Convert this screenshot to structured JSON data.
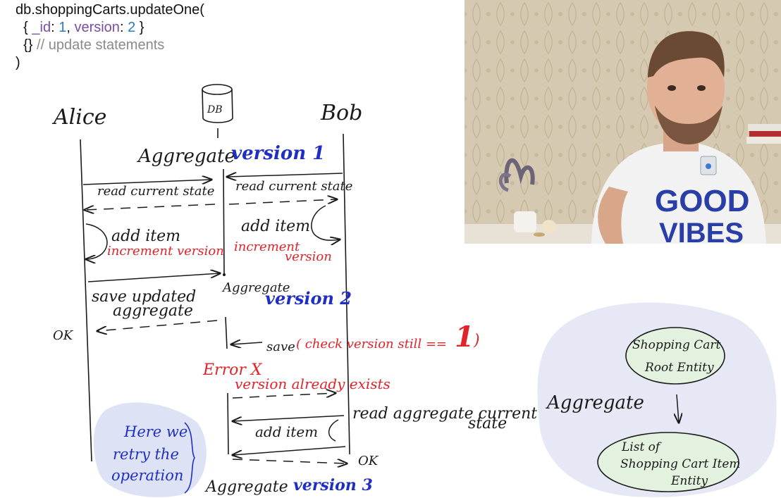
{
  "code": {
    "line1": "db.shoppingCarts.updateOne(",
    "l2_open": "{ ",
    "l2_key1": "_id",
    "l2_colon1": ": ",
    "l2_val1": "1",
    "l2_comma": ", ",
    "l2_key2": "version",
    "l2_colon2": ": ",
    "l2_val2": "2",
    "l2_close": " }",
    "l3_braces": "{} ",
    "l3_comment": "// update statements",
    "line4": ")"
  },
  "diagram": {
    "alice": "Alice",
    "db": "DB",
    "bob": "Bob",
    "aggregate_v1_prefix": "Aggregate",
    "version1": "version 1",
    "alice_read": "read current state",
    "bob_read": "read current state",
    "alice_add": "add item",
    "alice_incr": "increment version",
    "bob_add": "add item",
    "bob_incr_1": "increment",
    "bob_incr_2": "version",
    "save_updated_1": "save updated",
    "save_updated_2": "aggregate",
    "aggregate_v2_prefix": "Aggregate",
    "version2": "version 2",
    "ok_alice": "OK",
    "bob_save": "save",
    "bob_check": "( check version still == ",
    "bob_check_num": "1",
    "bob_check_close": ")",
    "error": "Error X",
    "version_exists": "version already exists",
    "read_agg_1": "read aggregate current",
    "read_agg_2": "state",
    "bob_add2": "add item",
    "ok_bob": "OK",
    "retry_1": "Here we",
    "retry_2": "retry the",
    "retry_3": "operation",
    "aggregate_v3_prefix": "Aggregate",
    "version3": "version 3"
  },
  "aggregate_panel": {
    "label": "Aggregate",
    "root_1": "Shopping Cart",
    "root_2": "Root Entity",
    "items_1": "List of",
    "items_2": "Shopping Cart Item",
    "items_3": "Entity"
  },
  "webcam": {
    "shirt_1": "GOOD",
    "shirt_2": "VIBES"
  },
  "colors": {
    "ink": "#1a1a1a",
    "blue": "#1f2fc4",
    "red": "#e0242a",
    "retry_bg": "#dde2f5",
    "aggregate_bg": "#e6e8f5",
    "entity_fill": "#e3f2df"
  }
}
